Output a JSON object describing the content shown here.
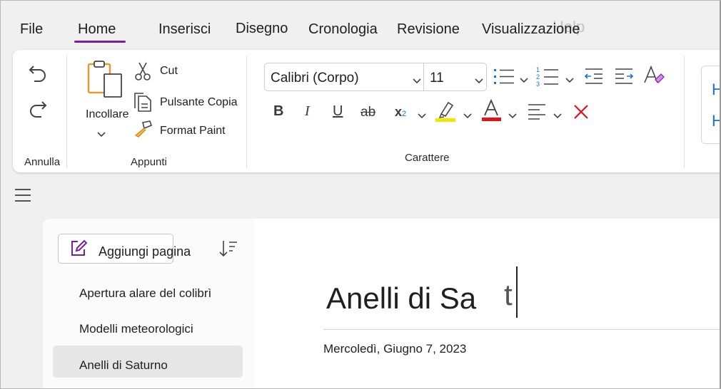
{
  "menu": {
    "tabs": [
      {
        "label": "File"
      },
      {
        "label": "Home"
      },
      {
        "label": "Inserisci"
      },
      {
        "label": "Disegno"
      },
      {
        "label": "Cronologia"
      },
      {
        "label": "Revisione"
      },
      {
        "label": "Visualizzazione"
      }
    ],
    "active_tab": "Home",
    "overflow_text": "Help",
    "accent_color": "#7a1fa2"
  },
  "ribbon": {
    "undo_group": {
      "label": "Annulla",
      "icons": [
        "undo-icon",
        "redo-icon"
      ]
    },
    "clipboard_group": {
      "label": "Appunti",
      "paste_label": "Incollare",
      "cut_label": "Cut",
      "copy_label": "Pulsante Copia",
      "format_painter_label": "Format Paint"
    },
    "font_group": {
      "label": "Carattere",
      "font_name": "Calibri (Corpo)",
      "font_size": "11",
      "bold_glyph": "B",
      "italic_glyph": "I",
      "underline_glyph": "U",
      "strike_glyph": "ab",
      "subscript_glyph": "x",
      "subscript_small": "2",
      "font_color_glyph": "A",
      "highlight_color": "#f2e600",
      "font_color": "#e3121a",
      "clear_color": "#e3121a"
    },
    "styles_preview": [
      "H",
      "H"
    ]
  },
  "pages": {
    "add_page_label": "Aggiungi pagina",
    "items": [
      {
        "label": "Apertura alare del colibrì",
        "selected": false
      },
      {
        "label": "Modelli meteorologici",
        "selected": false
      },
      {
        "label": "Anelli di Saturno",
        "selected": true
      }
    ]
  },
  "note": {
    "title": "Anelli di Sa",
    "title_tail": "t",
    "date": "Mercoledì, Giugno 7, 2023"
  }
}
